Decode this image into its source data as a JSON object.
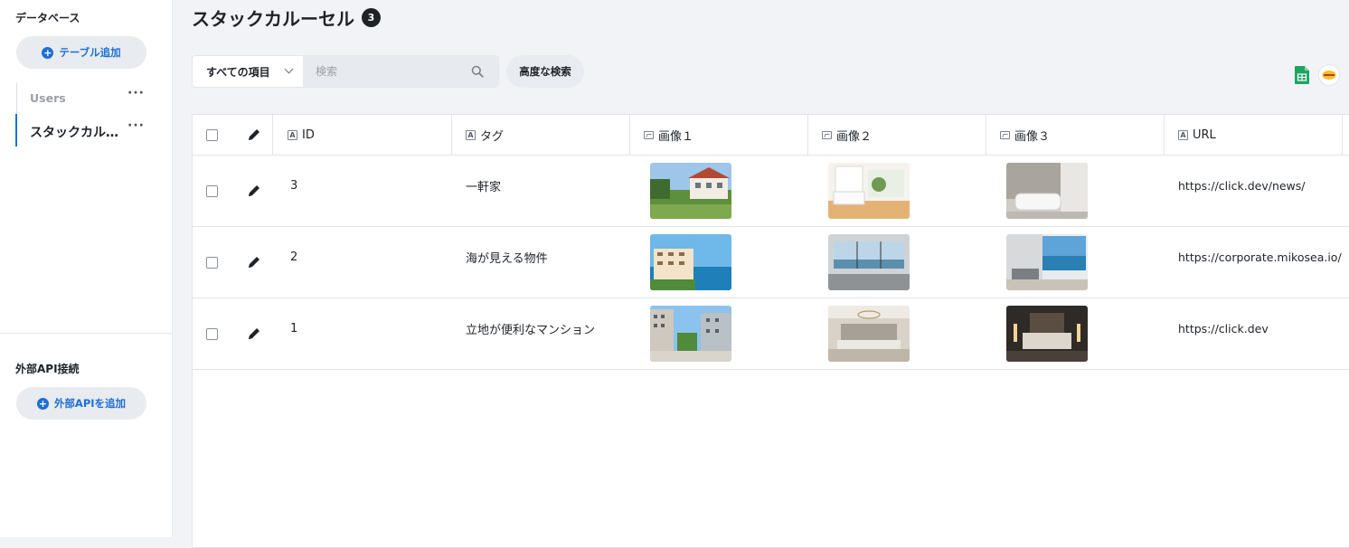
{
  "sidebar": {
    "db_heading": "データベース",
    "add_table_label": "テーブル追加",
    "tables": [
      {
        "label": "Users",
        "more": "···"
      },
      {
        "label": "スタックカルーセル",
        "more": "···"
      }
    ],
    "api_heading": "外部API接続",
    "add_api_label": "外部APIを追加"
  },
  "main": {
    "title": "スタックカルーセル",
    "count": "3",
    "filter_select": "すべての項目",
    "search_placeholder": "検索",
    "advanced_search": "高度な検索",
    "columns": [
      "ID",
      "タグ",
      "画像１",
      "画像２",
      "画像３",
      "URL"
    ],
    "rows": [
      {
        "id": "3",
        "tag": "一軒家",
        "url": "https://click.dev/news/"
      },
      {
        "id": "2",
        "tag": "海が見える物件",
        "url": "https://corporate.mikosea.io/"
      },
      {
        "id": "1",
        "tag": "立地が便利なマンション",
        "url": "https://click.dev"
      }
    ]
  },
  "colors": {
    "accent": "#1d6fd6",
    "badge": "#1f2328",
    "sheets_green": "#1fa463",
    "chip_yellow": "#f6c026"
  }
}
